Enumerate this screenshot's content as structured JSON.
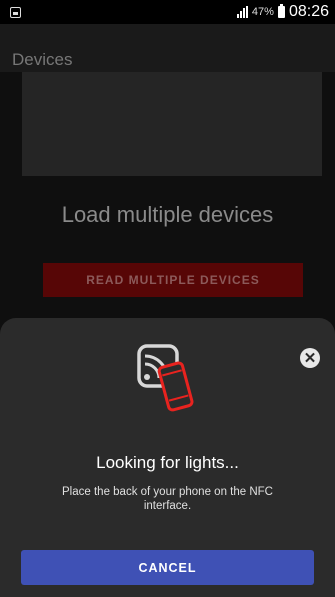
{
  "status_bar": {
    "battery_percent": "47%",
    "time": "08:26",
    "icons": [
      "photo-icon",
      "signal-icon",
      "battery-icon"
    ]
  },
  "app_bar": {
    "title": "Devices"
  },
  "main": {
    "heading": "Load multiple devices",
    "read_button_label": "READ MULTIPLE DEVICES"
  },
  "nfc_sheet": {
    "title": "Looking for lights...",
    "description": "Place the back of your phone on the NFC interface.",
    "cancel_label": "CANCEL",
    "close_icon": "close-icon",
    "nfc_icon": "nfc-phone-icon",
    "colors": {
      "sheet_bg": "#2b2b2b",
      "cancel_bg": "#3f51b5",
      "phone_icon": "#e8231f"
    }
  }
}
